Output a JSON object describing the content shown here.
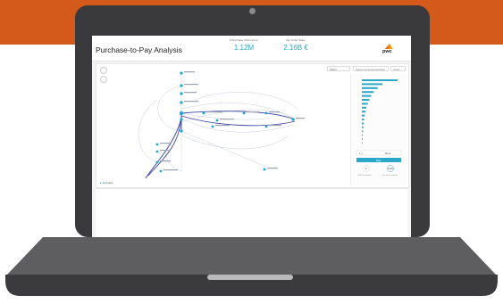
{
  "dashboard": {
    "title": "Purchase-to-Pay Analysis",
    "kpis": [
      {
        "label": "# Purchase Order Items",
        "value": "1.12M"
      },
      {
        "label": "Net Order Value",
        "value": "2.16B €"
      }
    ],
    "logo_text": "pwc"
  },
  "graph_toolbar": {
    "zoom_label": "Zoom",
    "filter_placeholder": "Select connected activities",
    "count_label": "Count"
  },
  "side_panel": {
    "bars": [
      0.95,
      0.55,
      0.42,
      0.32,
      0.25,
      0.2,
      0.16,
      0.12,
      0.1,
      0.08,
      0.06,
      0.05,
      0.04,
      0.03,
      0.02,
      0.02,
      0.015
    ],
    "selector_left": "1.x",
    "selector_right": "More",
    "apply_label": "Play",
    "metric_left": "0",
    "metric_right": "100%",
    "metric_left_caption": "1,078,0 variants",
    "metric_right_caption": "all cases covered"
  },
  "legend": {
    "label": "Activities"
  },
  "colors": {
    "banner": "#d35a1b",
    "accent": "#2ba8c8",
    "node": "#1aa6d8",
    "edge_dark": "#3d45a0"
  }
}
